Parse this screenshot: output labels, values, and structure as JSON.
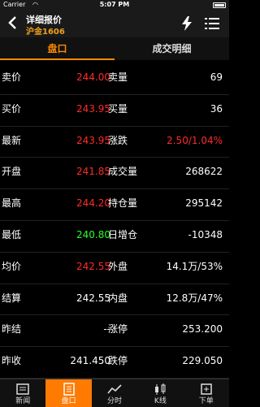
{
  "status_bar": {
    "carrier": "Carrier",
    "time": "5:07 PM"
  },
  "nav": {
    "title": "详细报价",
    "subtitle": "沪金1606"
  },
  "tabs": [
    {
      "label": "盘口"
    },
    {
      "label": "成交明细"
    }
  ],
  "quote_rows": [
    {
      "left_label": "卖价",
      "left_value": "244.00",
      "left_color": "red",
      "right_label": "卖量",
      "right_value": "69",
      "right_color": "white"
    },
    {
      "left_label": "买价",
      "left_value": "243.95",
      "left_color": "red",
      "right_label": "买量",
      "right_value": "36",
      "right_color": "white"
    },
    {
      "left_label": "最新",
      "left_value": "243.95",
      "left_color": "red",
      "right_label": "涨跌",
      "right_value": "2.50/1.04%",
      "right_color": "red"
    },
    {
      "left_label": "开盘",
      "left_value": "241.85",
      "left_color": "red",
      "right_label": "成交量",
      "right_value": "268622",
      "right_color": "white"
    },
    {
      "left_label": "最高",
      "left_value": "244.20",
      "left_color": "red",
      "right_label": "持仓量",
      "right_value": "295142",
      "right_color": "white"
    },
    {
      "left_label": "最低",
      "left_value": "240.80",
      "left_color": "green",
      "right_label": "日增仓",
      "right_value": "-10348",
      "right_color": "white"
    },
    {
      "left_label": "均价",
      "left_value": "242.55",
      "left_color": "red",
      "right_label": "外盘",
      "right_value": "14.1万/53%",
      "right_color": "white"
    },
    {
      "left_label": "结算",
      "left_value": "242.55",
      "left_color": "white",
      "right_label": "内盘",
      "right_value": "12.8万/47%",
      "right_color": "white"
    },
    {
      "left_label": "昨结",
      "left_value": "--",
      "left_color": "white",
      "right_label": "涨停",
      "right_value": "253.200",
      "right_color": "white"
    },
    {
      "left_label": "昨收",
      "left_value": "241.450",
      "left_color": "white",
      "right_label": "跌停",
      "right_value": "229.050",
      "right_color": "white"
    }
  ],
  "tabbar": [
    {
      "label": "新闻",
      "icon": "news-icon"
    },
    {
      "label": "盘口",
      "icon": "list-icon",
      "active": true
    },
    {
      "label": "分时",
      "icon": "line-chart-icon"
    },
    {
      "label": "K线",
      "icon": "candlestick-icon"
    },
    {
      "label": "下单",
      "icon": "order-icon"
    }
  ],
  "colors": {
    "accent": "#ff7a00",
    "up": "#ff2a2a",
    "down": "#28ff28",
    "subtitle": "#f0a020"
  }
}
